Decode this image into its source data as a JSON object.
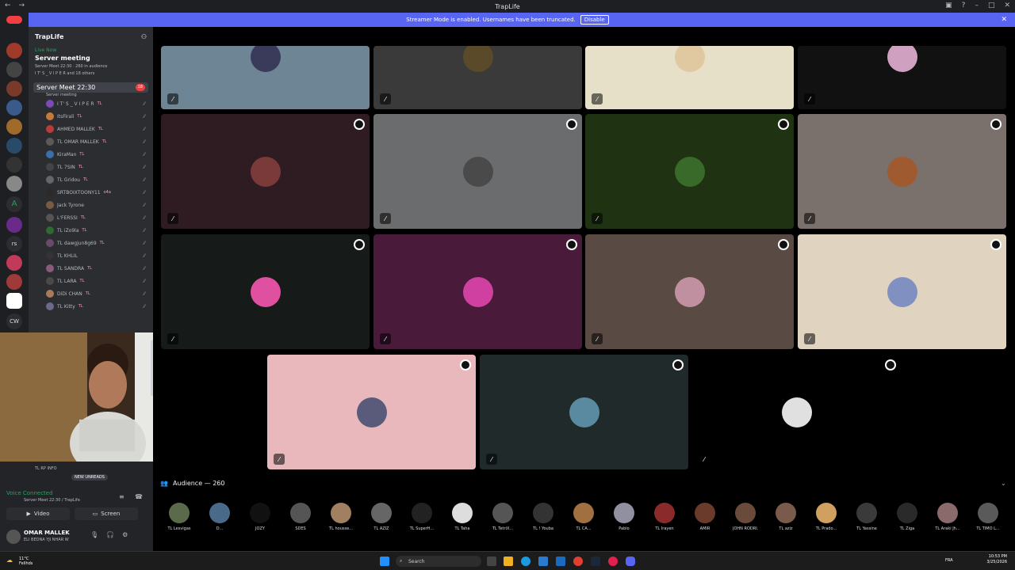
{
  "window": {
    "title": "TrapLife"
  },
  "streamer_banner": {
    "text": "Streamer Mode is enabled. Usernames have been truncated.",
    "disable_label": "Disable"
  },
  "server": {
    "name": "TrapLife"
  },
  "live_event": {
    "status": "Live Now",
    "title": "Server meeting",
    "meta": "Server Meet 22:30 · 260 in audience",
    "speakers": "I T' S _ V I P E R and 18 others"
  },
  "voice_channel": {
    "name": "Server Meet 22:30",
    "subtitle": "Server meeting",
    "count": "18"
  },
  "members": [
    {
      "name": "I T' S _ V I P E R",
      "tag": "TL",
      "color": "#7a4bb5"
    },
    {
      "name": "ItsFirali",
      "tag": "TL",
      "color": "#c47a3a"
    },
    {
      "name": "AHMED MALLEK",
      "tag": "TL",
      "color": "#b93b3b"
    },
    {
      "name": "TL OMAR MALLEK",
      "tag": "TL",
      "color": "#5a5a5a"
    },
    {
      "name": "KiraMan",
      "tag": "TL",
      "color": "#3a6fa8"
    },
    {
      "name": "TL 7SIN",
      "tag": "TL",
      "color": "#444"
    },
    {
      "name": "TL Gridou",
      "tag": "TL",
      "color": "#666"
    },
    {
      "name": "SRTBOIXTOONY11",
      "tag": "o4a",
      "color": "#2a2a2a"
    },
    {
      "name": "Jack Tyrone",
      "tag": "",
      "color": "#7a5a40"
    },
    {
      "name": "L'FERSSI",
      "tag": "TL",
      "color": "#555"
    },
    {
      "name": "TL iZo9la",
      "tag": "TL",
      "color": "#2f6a2f"
    },
    {
      "name": "TL dawgjun8g69",
      "tag": "TL",
      "color": "#6a4a6a"
    },
    {
      "name": "TL KHLIL",
      "tag": "",
      "color": "#333"
    },
    {
      "name": "TL SANDRA",
      "tag": "TL",
      "color": "#8a5a7a"
    },
    {
      "name": "TL LARA",
      "tag": "TL",
      "color": "#4a4a4a"
    },
    {
      "name": "DiDi CHAN",
      "tag": "TL",
      "color": "#a87a5a"
    },
    {
      "name": "TL Kitty",
      "tag": "TL",
      "color": "#6a6a8a"
    }
  ],
  "channel_snippet": {
    "label": "TL RP INFO",
    "new_unreads": "NEW UNREADS"
  },
  "voice_status": {
    "status": "Voice Connected",
    "channel": "Server Meet 22:30 / TrapLife",
    "video_label": "Video",
    "screen_label": "Screen"
  },
  "user": {
    "name": "OMAR MALLEK",
    "status": "ELI BEDNA YJI NHAR W"
  },
  "tiles": [
    {
      "bg": "#6e8596",
      "av": "#3a3a5a"
    },
    {
      "bg": "#3a3a3a",
      "av": "#5a4a2a"
    },
    {
      "bg": "#e6e0c8",
      "av": "#e0c8a0"
    },
    {
      "bg": "#111111",
      "av": "#d0a0c0"
    },
    {
      "bg": "#2e1c22",
      "av": "#7a3a3a"
    },
    {
      "bg": "#6a6c6e",
      "av": "#4a4a4a"
    },
    {
      "bg": "#1f3212",
      "av": "#3a6a2a"
    },
    {
      "bg": "#7a706c",
      "av": "#a05a30"
    },
    {
      "bg": "#161a18",
      "av": "#e050a0"
    },
    {
      "bg": "#4a1a3a",
      "av": "#d040a0"
    },
    {
      "bg": "#5a4a44",
      "av": "#c090a0"
    },
    {
      "bg": "#e0d4c0",
      "av": "#8090c0"
    },
    {
      "bg": "#e8b8bc",
      "av": "#5a5a7a"
    },
    {
      "bg": "#202a2a",
      "av": "#5a8aa0"
    },
    {
      "bg": "#000000",
      "av": "#e0e0e0"
    }
  ],
  "audience": {
    "label": "Audience — 260",
    "people": [
      {
        "name": "TL Lesvigas",
        "color": "#5a6a4a"
      },
      {
        "name": "D...",
        "color": "#4a6a8a"
      },
      {
        "name": "JOZY",
        "color": "#111"
      },
      {
        "name": "SDES",
        "color": "#555"
      },
      {
        "name": "TL housse...",
        "color": "#a08060"
      },
      {
        "name": "TL AZIZ",
        "color": "#666"
      },
      {
        "name": "TL SuperH...",
        "color": "#222"
      },
      {
        "name": "TL Taha",
        "color": "#ddd"
      },
      {
        "name": "TL TetriX...",
        "color": "#555"
      },
      {
        "name": "TL ! Youba",
        "color": "#333"
      },
      {
        "name": "TL CA...",
        "color": "#a07040"
      },
      {
        "name": "Pablo",
        "color": "#9090a0"
      },
      {
        "name": "TL Irayen",
        "color": "#8a2a2a"
      },
      {
        "name": "AMIR",
        "color": "#6a3a2a"
      },
      {
        "name": "JOHN RODRI...",
        "color": "#6a4a3a"
      },
      {
        "name": "TL aziz",
        "color": "#7a5a4a"
      },
      {
        "name": "TL Prado...",
        "color": "#d0a060"
      },
      {
        "name": "TL Yassine",
        "color": "#3a3a3a"
      },
      {
        "name": "TL Ziga",
        "color": "#2a2a2a"
      },
      {
        "name": "TL Araki Jh...",
        "color": "#8a6a6a"
      },
      {
        "name": "TL TIMO L...",
        "color": "#5a5a5a"
      }
    ]
  },
  "taskbar": {
    "weather_temp": "11°C",
    "weather_desc": "Fellhds",
    "search_placeholder": "Search",
    "lang": "FRA",
    "time": "10:53 PM",
    "date": "3/25/2026"
  }
}
